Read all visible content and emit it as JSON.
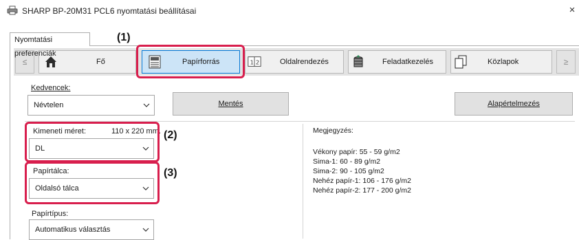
{
  "window": {
    "title": "SHARP BP-20M31 PCL6 nyomtatási beállításai",
    "close_glyph": "×"
  },
  "outer_tab": {
    "label": "Nyomtatási preferenciák"
  },
  "nav": {
    "prev_glyph": "≤",
    "next_glyph": "≥"
  },
  "tabs": [
    {
      "label": "Fő",
      "icon": "home-icon"
    },
    {
      "label": "Papírforrás",
      "icon": "paper-source-icon",
      "active": true
    },
    {
      "label": "Oldalrendezés",
      "icon": "layout-icon"
    },
    {
      "label": "Feladatkezelés",
      "icon": "job-handling-icon"
    },
    {
      "label": "Közlapok",
      "icon": "insert-pages-icon"
    }
  ],
  "favorites": {
    "label": "Kedvencek:",
    "value": "Névtelen",
    "save_label": "Mentés",
    "defaults_label": "Alapértelmezés"
  },
  "output_size": {
    "label": "Kimeneti méret:",
    "dims": "110 x 220 mm.",
    "value": "DL"
  },
  "paper_tray": {
    "label": "Papírtálca:",
    "value": "Oldalsó tálca"
  },
  "paper_type": {
    "label": "Papírtípus:",
    "value": "Automatikus választás"
  },
  "notes": {
    "label": "Megjegyzés:",
    "lines": [
      "Vékony papír: 55 - 59 g/m2",
      "Sima-1: 60 - 89 g/m2",
      "Sima-2: 90 - 105 g/m2",
      "Nehéz papír-1: 106 - 176 g/m2",
      "Nehéz papír-2: 177 - 200 g/m2"
    ]
  },
  "callouts": [
    "(1)",
    "(2)",
    "(3)"
  ],
  "colors": {
    "callout": "#d81e4d",
    "active_tab": "#cce4f7",
    "active_border": "#0078d7",
    "band": "#e3e3e3"
  }
}
